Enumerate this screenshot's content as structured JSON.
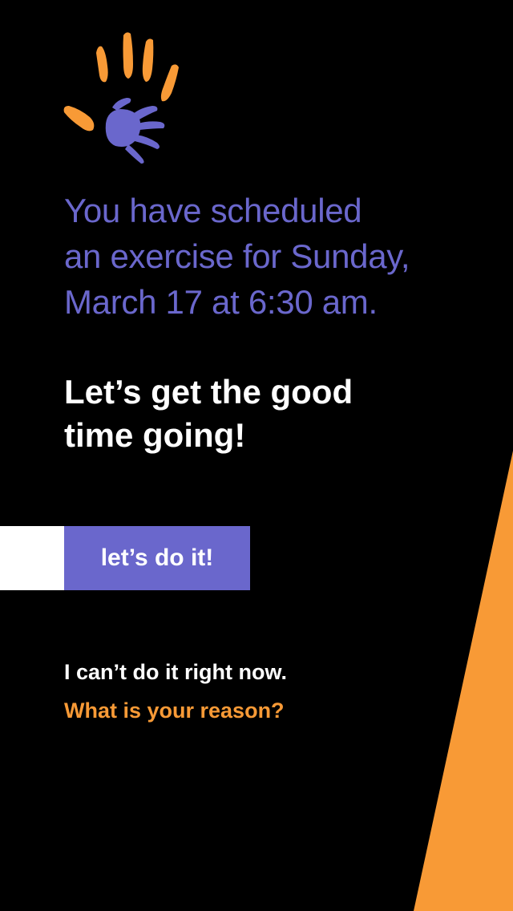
{
  "colors": {
    "background": "#000000",
    "accent_purple": "#6a67cc",
    "accent_orange": "#f89a36",
    "text_white": "#ffffff"
  },
  "logo": {
    "icon": "hands-logo-icon"
  },
  "schedule": {
    "line1": "You have scheduled",
    "line2": "an exercise for Sunday,",
    "line3": "March 17 at 6:30 am."
  },
  "motivation": {
    "line1": "Let’s get the good",
    "line2": "time going!"
  },
  "cta": {
    "label": "let’s do it!"
  },
  "decline": {
    "text": "I can’t do it right now.",
    "link_label": "What is your reason?"
  }
}
